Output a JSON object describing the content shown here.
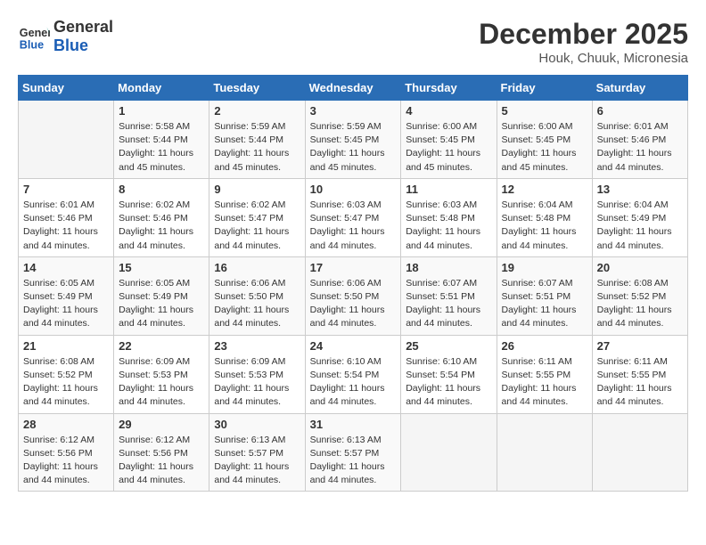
{
  "header": {
    "logo_line1": "General",
    "logo_line2": "Blue",
    "month": "December 2025",
    "location": "Houk, Chuuk, Micronesia"
  },
  "weekdays": [
    "Sunday",
    "Monday",
    "Tuesday",
    "Wednesday",
    "Thursday",
    "Friday",
    "Saturday"
  ],
  "weeks": [
    [
      {
        "day": "",
        "info": ""
      },
      {
        "day": "1",
        "info": "Sunrise: 5:58 AM\nSunset: 5:44 PM\nDaylight: 11 hours\nand 45 minutes."
      },
      {
        "day": "2",
        "info": "Sunrise: 5:59 AM\nSunset: 5:44 PM\nDaylight: 11 hours\nand 45 minutes."
      },
      {
        "day": "3",
        "info": "Sunrise: 5:59 AM\nSunset: 5:45 PM\nDaylight: 11 hours\nand 45 minutes."
      },
      {
        "day": "4",
        "info": "Sunrise: 6:00 AM\nSunset: 5:45 PM\nDaylight: 11 hours\nand 45 minutes."
      },
      {
        "day": "5",
        "info": "Sunrise: 6:00 AM\nSunset: 5:45 PM\nDaylight: 11 hours\nand 45 minutes."
      },
      {
        "day": "6",
        "info": "Sunrise: 6:01 AM\nSunset: 5:46 PM\nDaylight: 11 hours\nand 44 minutes."
      }
    ],
    [
      {
        "day": "7",
        "info": "Sunrise: 6:01 AM\nSunset: 5:46 PM\nDaylight: 11 hours\nand 44 minutes."
      },
      {
        "day": "8",
        "info": "Sunrise: 6:02 AM\nSunset: 5:46 PM\nDaylight: 11 hours\nand 44 minutes."
      },
      {
        "day": "9",
        "info": "Sunrise: 6:02 AM\nSunset: 5:47 PM\nDaylight: 11 hours\nand 44 minutes."
      },
      {
        "day": "10",
        "info": "Sunrise: 6:03 AM\nSunset: 5:47 PM\nDaylight: 11 hours\nand 44 minutes."
      },
      {
        "day": "11",
        "info": "Sunrise: 6:03 AM\nSunset: 5:48 PM\nDaylight: 11 hours\nand 44 minutes."
      },
      {
        "day": "12",
        "info": "Sunrise: 6:04 AM\nSunset: 5:48 PM\nDaylight: 11 hours\nand 44 minutes."
      },
      {
        "day": "13",
        "info": "Sunrise: 6:04 AM\nSunset: 5:49 PM\nDaylight: 11 hours\nand 44 minutes."
      }
    ],
    [
      {
        "day": "14",
        "info": "Sunrise: 6:05 AM\nSunset: 5:49 PM\nDaylight: 11 hours\nand 44 minutes."
      },
      {
        "day": "15",
        "info": "Sunrise: 6:05 AM\nSunset: 5:49 PM\nDaylight: 11 hours\nand 44 minutes."
      },
      {
        "day": "16",
        "info": "Sunrise: 6:06 AM\nSunset: 5:50 PM\nDaylight: 11 hours\nand 44 minutes."
      },
      {
        "day": "17",
        "info": "Sunrise: 6:06 AM\nSunset: 5:50 PM\nDaylight: 11 hours\nand 44 minutes."
      },
      {
        "day": "18",
        "info": "Sunrise: 6:07 AM\nSunset: 5:51 PM\nDaylight: 11 hours\nand 44 minutes."
      },
      {
        "day": "19",
        "info": "Sunrise: 6:07 AM\nSunset: 5:51 PM\nDaylight: 11 hours\nand 44 minutes."
      },
      {
        "day": "20",
        "info": "Sunrise: 6:08 AM\nSunset: 5:52 PM\nDaylight: 11 hours\nand 44 minutes."
      }
    ],
    [
      {
        "day": "21",
        "info": "Sunrise: 6:08 AM\nSunset: 5:52 PM\nDaylight: 11 hours\nand 44 minutes."
      },
      {
        "day": "22",
        "info": "Sunrise: 6:09 AM\nSunset: 5:53 PM\nDaylight: 11 hours\nand 44 minutes."
      },
      {
        "day": "23",
        "info": "Sunrise: 6:09 AM\nSunset: 5:53 PM\nDaylight: 11 hours\nand 44 minutes."
      },
      {
        "day": "24",
        "info": "Sunrise: 6:10 AM\nSunset: 5:54 PM\nDaylight: 11 hours\nand 44 minutes."
      },
      {
        "day": "25",
        "info": "Sunrise: 6:10 AM\nSunset: 5:54 PM\nDaylight: 11 hours\nand 44 minutes."
      },
      {
        "day": "26",
        "info": "Sunrise: 6:11 AM\nSunset: 5:55 PM\nDaylight: 11 hours\nand 44 minutes."
      },
      {
        "day": "27",
        "info": "Sunrise: 6:11 AM\nSunset: 5:55 PM\nDaylight: 11 hours\nand 44 minutes."
      }
    ],
    [
      {
        "day": "28",
        "info": "Sunrise: 6:12 AM\nSunset: 5:56 PM\nDaylight: 11 hours\nand 44 minutes."
      },
      {
        "day": "29",
        "info": "Sunrise: 6:12 AM\nSunset: 5:56 PM\nDaylight: 11 hours\nand 44 minutes."
      },
      {
        "day": "30",
        "info": "Sunrise: 6:13 AM\nSunset: 5:57 PM\nDaylight: 11 hours\nand 44 minutes."
      },
      {
        "day": "31",
        "info": "Sunrise: 6:13 AM\nSunset: 5:57 PM\nDaylight: 11 hours\nand 44 minutes."
      },
      {
        "day": "",
        "info": ""
      },
      {
        "day": "",
        "info": ""
      },
      {
        "day": "",
        "info": ""
      }
    ]
  ]
}
